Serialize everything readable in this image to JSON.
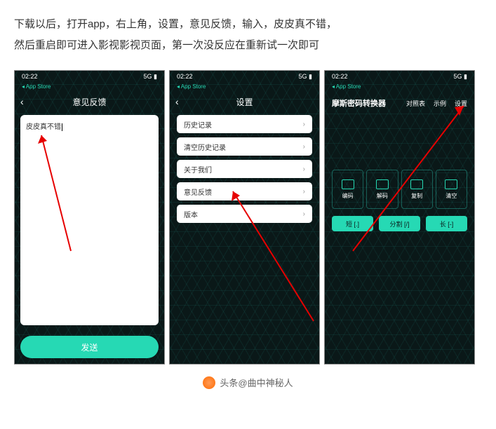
{
  "instructions": {
    "line1": "下载以后，打开app，右上角，设置，意见反馈，输入，皮皮真不错，",
    "line2": "然后重启即可进入影视影视页面，第一次没反应在重新试一次即可"
  },
  "status": {
    "time": "02:22",
    "signal": "5G",
    "store": "◂ App Store"
  },
  "phone1": {
    "title": "意见反馈",
    "input_text": "皮皮真不错",
    "send": "发送"
  },
  "phone2": {
    "title": "设置",
    "items": [
      "历史记录",
      "清空历史记录",
      "关于我们",
      "意见反馈",
      "版本"
    ]
  },
  "phone3": {
    "title": "摩斯密码转换器",
    "nav": [
      "对照表",
      "示例",
      "设置"
    ],
    "tools": [
      "编码",
      "解码",
      "复制",
      "清空"
    ],
    "pills": [
      "短 [.]",
      "分割 [/]",
      "长 [-]"
    ]
  },
  "byline": {
    "prefix": "头条",
    "at": "@",
    "name": "曲中神秘人"
  }
}
